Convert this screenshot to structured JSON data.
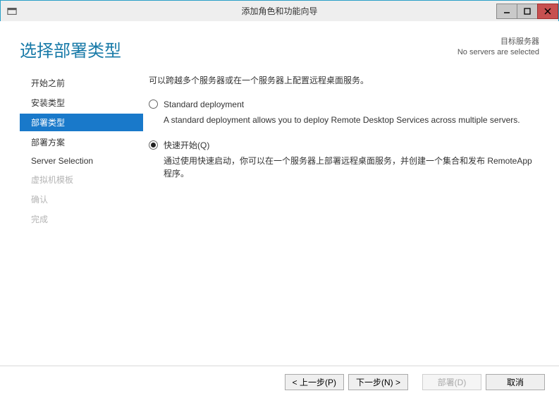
{
  "window": {
    "title": "添加角色和功能向导"
  },
  "header": {
    "page_title": "选择部署类型",
    "target_label": "目标服务器",
    "target_status": "No servers are selected"
  },
  "sidebar": {
    "items": [
      {
        "label": "开始之前",
        "state": "normal"
      },
      {
        "label": "安装类型",
        "state": "normal"
      },
      {
        "label": "部署类型",
        "state": "selected"
      },
      {
        "label": "部署方案",
        "state": "normal"
      },
      {
        "label": "Server Selection",
        "state": "normal"
      },
      {
        "label": "虚拟机模板",
        "state": "disabled"
      },
      {
        "label": "确认",
        "state": "disabled"
      },
      {
        "label": "完成",
        "state": "disabled"
      }
    ]
  },
  "main": {
    "intro": "可以跨越多个服务器或在一个服务器上配置远程桌面服务。",
    "options": [
      {
        "id": "standard",
        "label": "Standard deployment",
        "description": "A standard deployment allows you to deploy Remote Desktop Services across multiple servers.",
        "checked": false
      },
      {
        "id": "quick",
        "label": "快速开始(Q)",
        "description": "通过使用快速启动，你可以在一个服务器上部署远程桌面服务，并创建一个集合和发布 RemoteApp 程序。",
        "checked": true
      }
    ]
  },
  "footer": {
    "prev": "< 上一步(P)",
    "next": "下一步(N) >",
    "deploy": "部署(D)",
    "cancel": "取消"
  }
}
